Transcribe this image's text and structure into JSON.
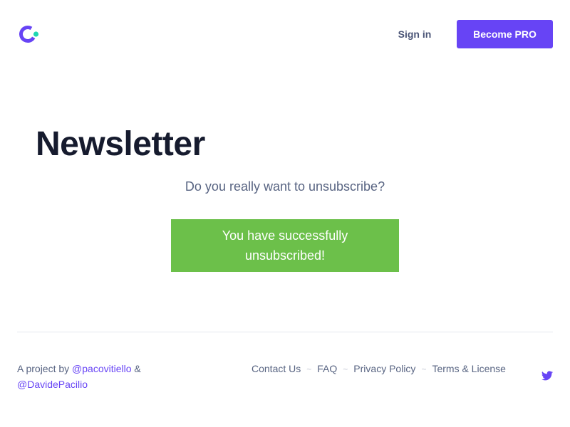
{
  "header": {
    "signin_label": "Sign in",
    "cta_label": "Become PRO"
  },
  "main": {
    "title": "Newsletter",
    "question": "Do you really want to unsubscribe?",
    "success_message": "You have successfully unsubscribed!"
  },
  "footer": {
    "credit_prefix": "A project by",
    "author1": "@pacovitiello",
    "conjunction": "&",
    "author2": "@DavidePacilio",
    "links": [
      "Contact Us",
      "FAQ",
      "Privacy Policy",
      "Terms & License"
    ],
    "separator": "~",
    "social_icon": "twitter-icon"
  },
  "colors": {
    "accent": "#6744f5",
    "success": "#6cc04a",
    "logo_dot": "#1fd6b2",
    "text_dark": "#161b2e",
    "text_muted": "#586482"
  }
}
